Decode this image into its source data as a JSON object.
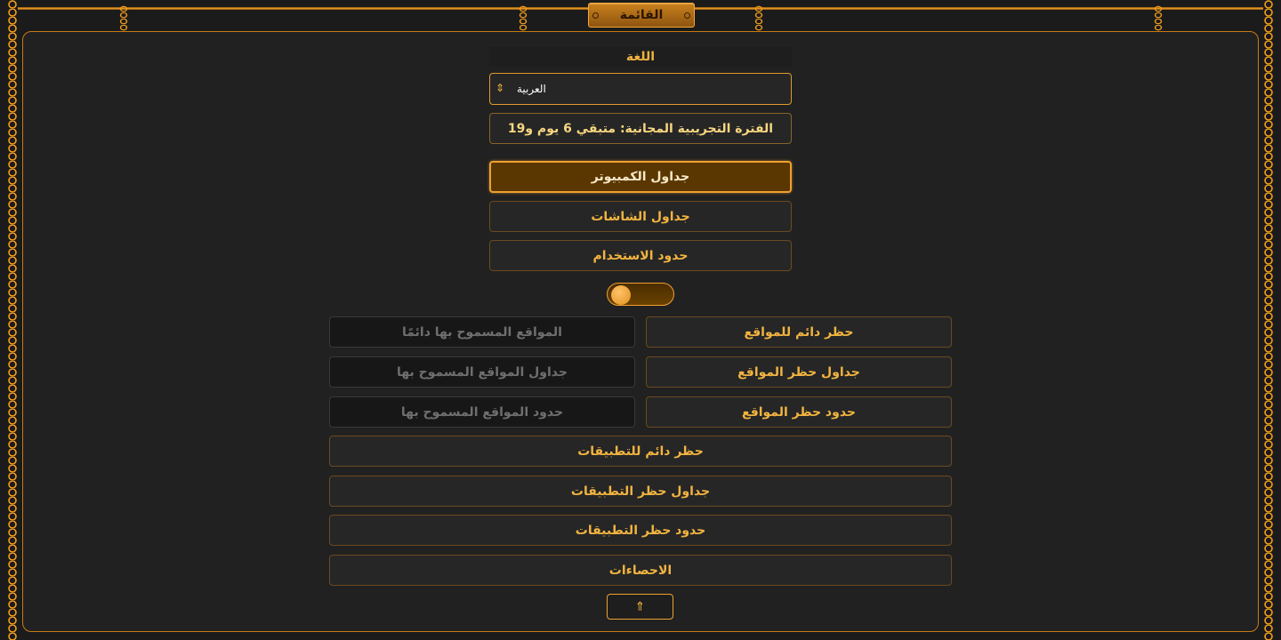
{
  "menu": {
    "title": "القائمة"
  },
  "language": {
    "label": "اللغة",
    "selected": "العربية",
    "arrows_icon": "⇕"
  },
  "trial_text": "الفترة التجريبية المجانية: متبقي 6 يوم و19",
  "buttons": {
    "computer_schedules": "جداول الكمبيوتر",
    "screen_schedules": "جداول الشاشات",
    "usage_limits": "حدود الاستخدام",
    "permanent_site_block": "حظر دائم للمواقع",
    "site_block_schedules": "جداول حظر المواقع",
    "site_block_limits": "حدود حظر المواقع",
    "always_allowed_sites": "المواقع المسموح بها دائمًا",
    "allowed_site_schedules": "جداول المواقع المسموح بها",
    "allowed_site_limits": "حدود المواقع المسموح بها",
    "permanent_app_block": "حظر دائم للتطبيقات",
    "app_block_schedules": "جداول حظر التطبيقات",
    "app_block_limits": "حدود حظر التطبيقات",
    "statistics": "الاحصاءات",
    "up_icon": "⇑"
  },
  "toggle": {
    "state": "off"
  },
  "colors": {
    "accent": "#f0a030",
    "text_gold": "#f2b440",
    "background": "#1b1b1b",
    "panel": "#212121",
    "active_button": "#5a3700"
  }
}
